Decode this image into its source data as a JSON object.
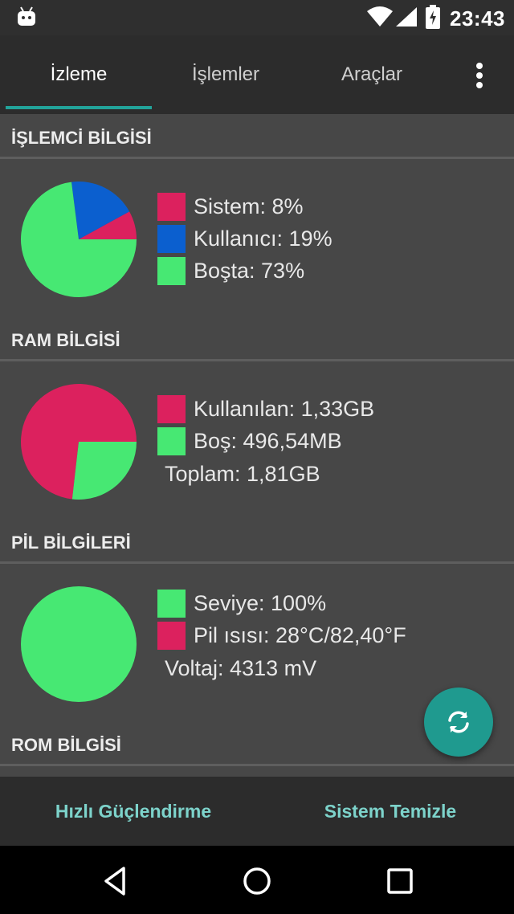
{
  "status_bar": {
    "time": "23:43",
    "icons": [
      "android-icon",
      "wifi-icon",
      "signal-icon",
      "battery-charging-icon"
    ]
  },
  "tabs": [
    {
      "label": "İzleme"
    },
    {
      "label": "İşlemler"
    },
    {
      "label": "Araçlar"
    }
  ],
  "active_tab": "İzleme",
  "sections": {
    "cpu": {
      "title": "İŞLEMCİ BİLGİSİ",
      "legend": [
        {
          "label": "Sistem: 8%",
          "color": "#dc215e"
        },
        {
          "label": "Kullanıcı: 19%",
          "color": "#0b5fcf"
        },
        {
          "label": "Boşta: 73%",
          "color": "#47e873"
        }
      ],
      "pie": [
        {
          "name": "Sistem",
          "value": 8,
          "color": "#dc215e"
        },
        {
          "name": "Kullanıcı",
          "value": 19,
          "color": "#0b5fcf"
        },
        {
          "name": "Boşta",
          "value": 73,
          "color": "#47e873"
        }
      ]
    },
    "ram": {
      "title": "RAM BİLGİSİ",
      "legend": [
        {
          "label": "Kullanılan: 1,33GB",
          "color": "#dc215e"
        },
        {
          "label": "Boş: 496,54MB",
          "color": "#47e873"
        }
      ],
      "total": "Toplam: 1,81GB",
      "pie": [
        {
          "name": "Kullanılan",
          "value": 73.2,
          "color": "#dc215e"
        },
        {
          "name": "Boş",
          "value": 26.8,
          "color": "#47e873"
        }
      ]
    },
    "battery": {
      "title": "PİL BİLGİLERİ",
      "legend": [
        {
          "label": "Seviye: 100%",
          "color": "#47e873"
        },
        {
          "label": "Pil ısısı: 28°C/82,40°F",
          "color": "#dc215e"
        }
      ],
      "voltage": "Voltaj: 4313 mV",
      "pie": [
        {
          "name": "Seviye",
          "value": 100,
          "color": "#47e873"
        }
      ]
    },
    "rom": {
      "title": "ROM BİLGİSİ"
    }
  },
  "bottom_buttons": {
    "boost": "Hızlı Güçlendirme",
    "clean": "Sistem Temizle"
  },
  "colors": {
    "accent": "#22a39a",
    "fab": "#1f9a8f",
    "bottom_text": "#7dd3cb"
  }
}
